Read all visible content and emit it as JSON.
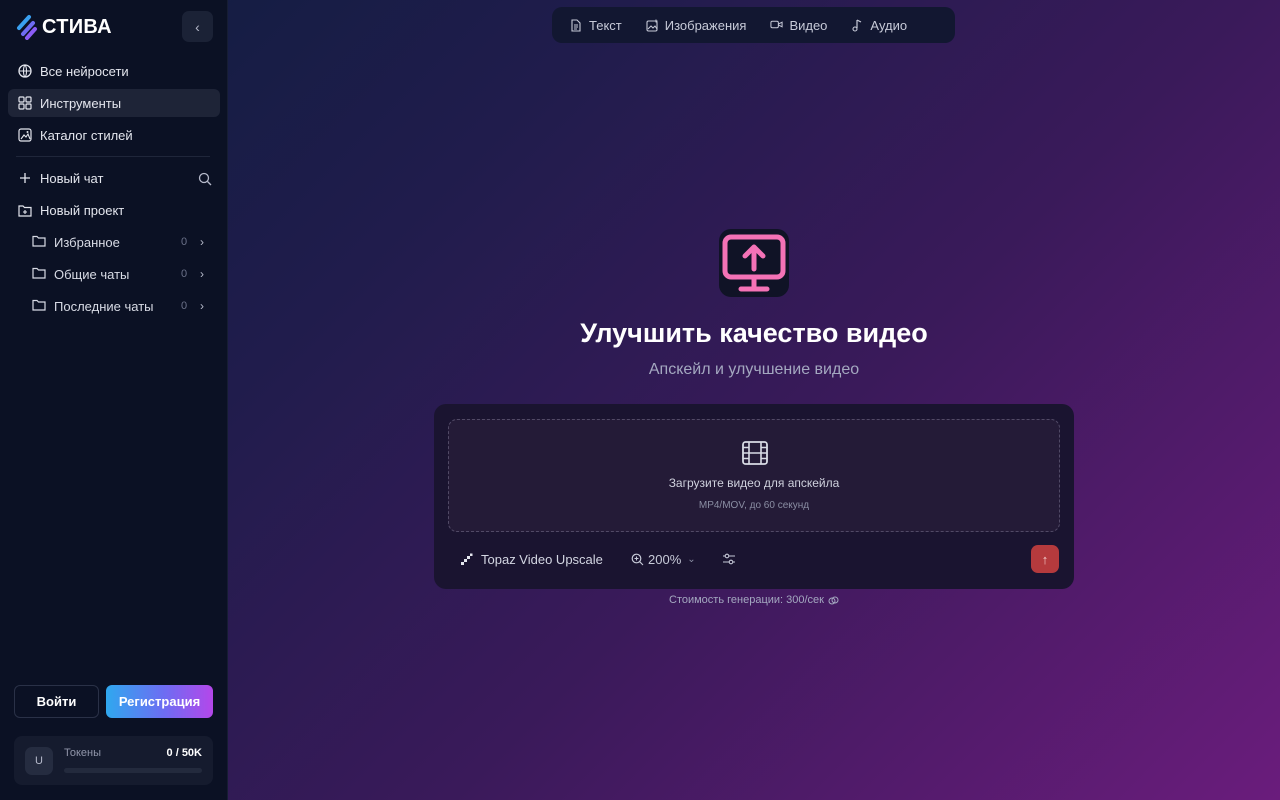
{
  "app": {
    "brand": "СТИВА"
  },
  "sidebar": {
    "collapse_icon": "chevron-left-icon",
    "nav": [
      {
        "label": "Все нейросети",
        "icon": "globe-icon",
        "active": false
      },
      {
        "label": "Инструменты",
        "icon": "grid-icon",
        "active": true
      },
      {
        "label": "Каталог стилей",
        "icon": "gallery-icon",
        "active": false
      }
    ],
    "new_chat": {
      "label": "Новый чат",
      "icon": "plus-icon"
    },
    "new_project": {
      "label": "Новый проект",
      "icon": "folder-plus-icon"
    },
    "folders": [
      {
        "label": "Избранное",
        "count": "0"
      },
      {
        "label": "Общие чаты",
        "count": "0"
      },
      {
        "label": "Последние чаты",
        "count": "0"
      }
    ],
    "login_label": "Войти",
    "register_label": "Регистрация",
    "tokens": {
      "avatar": "U",
      "label": "Токены",
      "value": "0 / 50K",
      "progress": 0
    }
  },
  "topbar": {
    "tabs": [
      {
        "label": "Текст",
        "icon": "document-icon"
      },
      {
        "label": "Изображения",
        "icon": "image-plus-icon"
      },
      {
        "label": "Видео",
        "icon": "video-icon"
      },
      {
        "label": "Аудио",
        "icon": "music-note-icon"
      }
    ]
  },
  "main": {
    "hero_icon": "monitor-upload-icon",
    "title": "Улучшить качество видео",
    "subtitle": "Апскейл и улучшение видео",
    "dropzone": {
      "icon": "film-icon",
      "title": "Загрузите видео для апскейла",
      "hint": "MP4/MOV, до 60 секунд"
    },
    "model": "Topaz Video Upscale",
    "scale": "200%",
    "cost": "Стоимость генерации: 300/сек"
  },
  "colors": {
    "accent_pink": "#f472b6",
    "send_button": "#b53a3d",
    "register_gradient_start": "#2fa8ef",
    "register_gradient_end": "#b447ea"
  }
}
